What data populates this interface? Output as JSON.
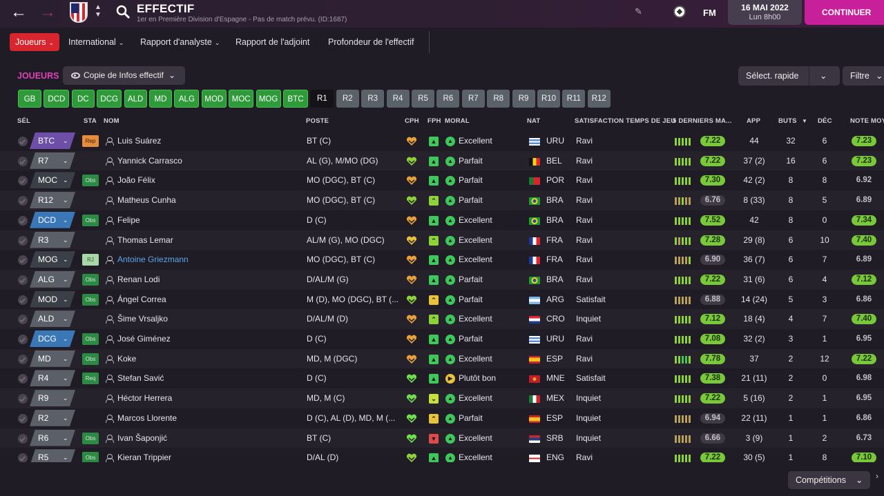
{
  "topbar": {
    "title": "EFFECTIF",
    "subtitle": "1er en Première Division d'Espagne - Pas de match prévu. (ID:1687)",
    "fm_label": "FM",
    "date": "16 MAI 2022",
    "time": "Lun 8h00",
    "continue_label": "CONTINUER"
  },
  "tabs": [
    "Joueurs",
    "International",
    "Rapport d'analyste",
    "Rapport de l'adjoint",
    "Profondeur de l'effectif"
  ],
  "toolbar": {
    "section_label": "JOUEURS",
    "copy_label": "Copie de Infos effectif",
    "quick_select": "Sélect. rapide",
    "filter": "Filtre"
  },
  "positions": [
    "GB",
    "DCD",
    "DC",
    "DCG",
    "ALD",
    "MD",
    "ALG",
    "MOD",
    "MOC",
    "MOG",
    "BTC",
    "R1",
    "R2",
    "R3",
    "R4",
    "R5",
    "R6",
    "R7",
    "R8",
    "R9",
    "R10",
    "R11",
    "R12"
  ],
  "columns": {
    "sel": "SÉL",
    "sta": "STA",
    "nom": "NOM",
    "poste": "POSTE",
    "cph": "CPH",
    "fph": "FPH",
    "moral": "MORAL",
    "nat": "NAT",
    "satisfaction": "SATISFACTION TEMPS DE JEU",
    "form": "5 DERNIERS MA...",
    "app": "APP",
    "buts": "BUTS",
    "dec": "DÉC",
    "note": "NOTE MOY"
  },
  "colors": {
    "accent": "#c8209a",
    "active_tab": "#d9262e",
    "rating_green": "#78c83a",
    "position_green": "#2f9a3a"
  },
  "players": [
    {
      "pos": "BTC",
      "sta": "Rep",
      "name": "Luis Suárez",
      "poste": "BT (C)",
      "moral": "Excellent",
      "nat": "URU",
      "sat": "Ravi",
      "form": "7.22",
      "app": "44",
      "buts": "32",
      "dec": "6",
      "note": "7.23"
    },
    {
      "pos": "R7",
      "sta": "",
      "name": "Yannick Carrasco",
      "poste": "AL (G), M/MO (DG)",
      "moral": "Parfait",
      "nat": "BEL",
      "sat": "Ravi",
      "form": "7.22",
      "app": "37 (2)",
      "buts": "16",
      "dec": "6",
      "note": "7.23"
    },
    {
      "pos": "MOC",
      "sta": "Obs",
      "name": "João Félix",
      "poste": "MO (DGC), BT (C)",
      "moral": "Parfait",
      "nat": "POR",
      "sat": "Ravi",
      "form": "7.30",
      "app": "42 (2)",
      "buts": "8",
      "dec": "8",
      "note": "6.92"
    },
    {
      "pos": "R12",
      "sta": "",
      "name": "Matheus Cunha",
      "poste": "MO (DGC), BT (C)",
      "moral": "Parfait",
      "nat": "BRA",
      "sat": "Ravi",
      "form": "6.76",
      "app": "8 (33)",
      "buts": "8",
      "dec": "5",
      "note": "6.89"
    },
    {
      "pos": "DCD",
      "sta": "Obs",
      "name": "Felipe",
      "poste": "D (C)",
      "moral": "Excellent",
      "nat": "BRA",
      "sat": "Ravi",
      "form": "7.52",
      "app": "42",
      "buts": "8",
      "dec": "0",
      "note": "7.34"
    },
    {
      "pos": "R3",
      "sta": "",
      "name": "Thomas Lemar",
      "poste": "AL/M (G), MO (DGC)",
      "moral": "Excellent",
      "nat": "FRA",
      "sat": "Ravi",
      "form": "7.28",
      "app": "29 (8)",
      "buts": "6",
      "dec": "10",
      "note": "7.40"
    },
    {
      "pos": "MOG",
      "sta": "RJ",
      "name": "Antoine Griezmann",
      "poste": "MO (DGC), BT (C)",
      "moral": "Excellent",
      "nat": "FRA",
      "sat": "Ravi",
      "form": "6.90",
      "app": "36 (7)",
      "buts": "6",
      "dec": "7",
      "note": "6.89"
    },
    {
      "pos": "ALG",
      "sta": "Obs",
      "name": "Renan Lodi",
      "poste": "D/AL/M (G)",
      "moral": "Parfait",
      "nat": "BRA",
      "sat": "Ravi",
      "form": "7.22",
      "app": "31 (6)",
      "buts": "6",
      "dec": "4",
      "note": "7.12"
    },
    {
      "pos": "MOD",
      "sta": "Obs",
      "name": "Ángel Correa",
      "poste": "M (D), MO (DGC), BT (...",
      "moral": "Parfait",
      "nat": "ARG",
      "sat": "Satisfait",
      "form": "6.88",
      "app": "14 (24)",
      "buts": "5",
      "dec": "3",
      "note": "6.86"
    },
    {
      "pos": "ALD",
      "sta": "",
      "name": "Šime Vrsaljko",
      "poste": "D/AL/M (D)",
      "moral": "Excellent",
      "nat": "CRO",
      "sat": "Inquiet",
      "form": "7.12",
      "app": "18 (4)",
      "buts": "4",
      "dec": "7",
      "note": "7.40"
    },
    {
      "pos": "DCG",
      "sta": "Obs",
      "name": "José Giménez",
      "poste": "D (C)",
      "moral": "Parfait",
      "nat": "URU",
      "sat": "Ravi",
      "form": "7.08",
      "app": "32 (2)",
      "buts": "3",
      "dec": "1",
      "note": "6.95"
    },
    {
      "pos": "MD",
      "sta": "Obs",
      "name": "Koke",
      "poste": "MD, M (DGC)",
      "moral": "Excellent",
      "nat": "ESP",
      "sat": "Ravi",
      "form": "7.78",
      "app": "37",
      "buts": "2",
      "dec": "12",
      "note": "7.22"
    },
    {
      "pos": "R4",
      "sta": "Req",
      "name": "Stefan Savić",
      "poste": "D (C)",
      "moral": "Plutôt bon",
      "nat": "MNE",
      "sat": "Satisfait",
      "form": "7.38",
      "app": "21 (11)",
      "buts": "2",
      "dec": "0",
      "note": "6.98"
    },
    {
      "pos": "R9",
      "sta": "",
      "name": "Héctor Herrera",
      "poste": "MD, M (C)",
      "moral": "Excellent",
      "nat": "MEX",
      "sat": "Inquiet",
      "form": "7.22",
      "app": "5 (16)",
      "buts": "2",
      "dec": "1",
      "note": "6.95"
    },
    {
      "pos": "R2",
      "sta": "",
      "name": "Marcos Llorente",
      "poste": "D (C), AL (D), MD, M (...",
      "moral": "Parfait",
      "nat": "ESP",
      "sat": "Inquiet",
      "form": "6.94",
      "app": "22 (11)",
      "buts": "1",
      "dec": "1",
      "note": "6.86"
    },
    {
      "pos": "R6",
      "sta": "Obs",
      "name": "Ivan Šaponjić",
      "poste": "BT (C)",
      "moral": "Excellent",
      "nat": "SRB",
      "sat": "Inquiet",
      "form": "6.66",
      "app": "3 (9)",
      "buts": "1",
      "dec": "2",
      "note": "6.73"
    },
    {
      "pos": "R5",
      "sta": "Obs",
      "name": "Kieran Trippier",
      "poste": "D/AL (D)",
      "moral": "Excellent",
      "nat": "ENG",
      "sat": "Ravi",
      "form": "7.22",
      "app": "30 (5)",
      "buts": "1",
      "dec": "8",
      "note": "7.10"
    }
  ],
  "bottom": {
    "competitions": "Compétitions"
  }
}
